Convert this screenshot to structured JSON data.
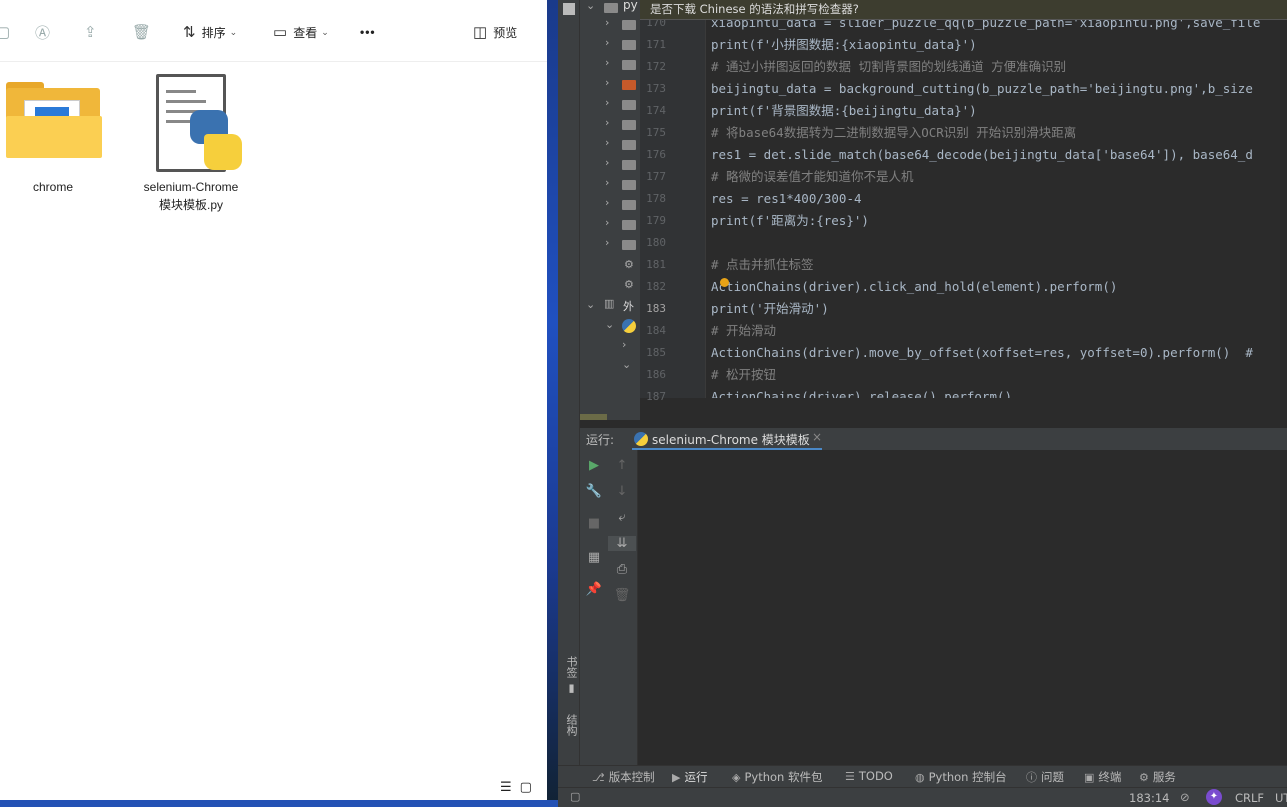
{
  "explorer": {
    "toolbar": {
      "sort_label": "排序",
      "view_label": "查看",
      "more_label": "•••",
      "preview_label": "预览"
    },
    "files": [
      {
        "name_line1": "chrome",
        "name_line2": "",
        "icon": "folder-icon"
      },
      {
        "name_line1": "selenium-Chrome",
        "name_line2": "模块模板.py",
        "icon": "python-file-icon"
      }
    ]
  },
  "ide": {
    "notification": "是否下载 Chinese 的语法和拼写检查器?",
    "tree_partial_label": "py",
    "tree_label_ext": "外",
    "gutter_lines": [
      "170",
      "171",
      "172",
      "173",
      "174",
      "175",
      "176",
      "177",
      "178",
      "179",
      "180",
      "181",
      "182",
      "183",
      "184",
      "185",
      "186",
      "187"
    ],
    "code_lines": [
      "xiaopintu_data = slider_puzzle_qq(b_puzzle_path='xiaopintu.png',save_file",
      "print(f'小拼图数据:{xiaopintu_data}')",
      "# 通过小拼图返回的数据 切割背景图的划线通道 方便准确识别",
      "beijingtu_data = background_cutting(b_puzzle_path='beijingtu.png',b_size",
      "print(f'背景图数据:{beijingtu_data}')",
      "# 将base64数据转为二进制数据导入OCR识别 开始识别滑块距离",
      "res1 = det.slide_match(base64_decode(beijingtu_data['base64']), base64_d",
      "# 略微的误差值才能知道你不是人机",
      "res = res1*400/300-4",
      "print(f'距离为:{res}')",
      "",
      "# 点击并抓住标签",
      "ActionChains(driver).click_and_hold(element).perform()",
      "print('开始滑动')",
      "# 开始滑动",
      "ActionChains(driver).move_by_offset(xoffset=res, yoffset=0).perform()  #",
      "# 松开按钮",
      "ActionChains(driver).release().perform()"
    ],
    "run": {
      "label": "运行:",
      "tab_name": "selenium-Chrome 模块模板",
      "close": "×"
    },
    "side_tabs": {
      "bookmarks": "书签",
      "structure": "结构"
    },
    "bottom_tabs": [
      {
        "icon": "⎇",
        "label": "版本控制"
      },
      {
        "icon": "▶",
        "label": "运行"
      },
      {
        "icon": "◈",
        "label": "Python 软件包"
      },
      {
        "icon": "☰",
        "label": "TODO"
      },
      {
        "icon": "◍",
        "label": "Python 控制台"
      },
      {
        "icon": "ⓘ",
        "label": "问题"
      },
      {
        "icon": "▣",
        "label": "终端"
      },
      {
        "icon": "⚙",
        "label": "服务"
      }
    ],
    "status": {
      "position": "183:14",
      "line_sep": "CRLF",
      "encoding": "UT"
    }
  }
}
